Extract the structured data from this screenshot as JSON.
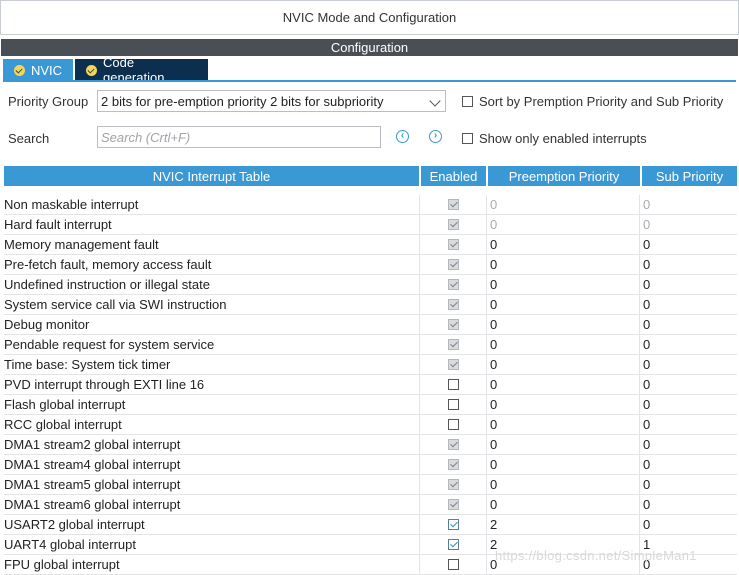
{
  "window": {
    "title": "NVIC Mode and Configuration"
  },
  "section": {
    "title": "Configuration"
  },
  "tabs": [
    {
      "label": "NVIC",
      "active": true
    },
    {
      "label": "Code generation",
      "active": false
    }
  ],
  "controls": {
    "priority_group_label": "Priority Group",
    "priority_group_value": "2 bits for pre-emption priority 2 bits for subpriority",
    "sort_label": "Sort by Premption Priority and Sub Priority",
    "search_label": "Search",
    "search_placeholder": "Search (Crtl+F)",
    "prev_glyph": "‹",
    "next_glyph": "›",
    "show_enabled_label": "Show only enabled interrupts"
  },
  "table": {
    "headers": {
      "name": "NVIC Interrupt Table",
      "enabled": "Enabled",
      "preemption": "Preemption Priority",
      "sub": "Sub Priority"
    },
    "rows": [
      {
        "name": "Non maskable interrupt",
        "enabled": "fixed",
        "preemption": "0",
        "sub": "0",
        "dim": true
      },
      {
        "name": "Hard fault interrupt",
        "enabled": "fixed",
        "preemption": "0",
        "sub": "0",
        "dim": true
      },
      {
        "name": "Memory management fault",
        "enabled": "fixed",
        "preemption": "0",
        "sub": "0",
        "dim": false
      },
      {
        "name": "Pre-fetch fault, memory access fault",
        "enabled": "fixed",
        "preemption": "0",
        "sub": "0",
        "dim": false
      },
      {
        "name": "Undefined instruction or illegal state",
        "enabled": "fixed",
        "preemption": "0",
        "sub": "0",
        "dim": false
      },
      {
        "name": "System service call via SWI instruction",
        "enabled": "fixed",
        "preemption": "0",
        "sub": "0",
        "dim": false
      },
      {
        "name": "Debug monitor",
        "enabled": "fixed",
        "preemption": "0",
        "sub": "0",
        "dim": false
      },
      {
        "name": "Pendable request for system service",
        "enabled": "fixed",
        "preemption": "0",
        "sub": "0",
        "dim": false
      },
      {
        "name": "Time base: System tick timer",
        "enabled": "fixed",
        "preemption": "0",
        "sub": "0",
        "dim": false
      },
      {
        "name": "PVD interrupt through EXTI line 16",
        "enabled": "off",
        "preemption": "0",
        "sub": "0",
        "dim": false
      },
      {
        "name": "Flash global interrupt",
        "enabled": "off",
        "preemption": "0",
        "sub": "0",
        "dim": false
      },
      {
        "name": "RCC global interrupt",
        "enabled": "off",
        "preemption": "0",
        "sub": "0",
        "dim": false
      },
      {
        "name": "DMA1 stream2 global interrupt",
        "enabled": "fixed",
        "preemption": "0",
        "sub": "0",
        "dim": false
      },
      {
        "name": "DMA1 stream4 global interrupt",
        "enabled": "fixed",
        "preemption": "0",
        "sub": "0",
        "dim": false
      },
      {
        "name": "DMA1 stream5 global interrupt",
        "enabled": "fixed",
        "preemption": "0",
        "sub": "0",
        "dim": false
      },
      {
        "name": "DMA1 stream6 global interrupt",
        "enabled": "fixed",
        "preemption": "0",
        "sub": "0",
        "dim": false
      },
      {
        "name": "USART2 global interrupt",
        "enabled": "on",
        "preemption": "2",
        "sub": "0",
        "dim": false
      },
      {
        "name": "UART4 global interrupt",
        "enabled": "on",
        "preemption": "2",
        "sub": "1",
        "dim": false
      },
      {
        "name": "FPU global interrupt",
        "enabled": "off",
        "preemption": "0",
        "sub": "0",
        "dim": false
      }
    ]
  },
  "watermark": "https://blog.csdn.net/SimpleMan1",
  "colors": {
    "accent": "#3a99d5",
    "tab_dark": "#0c2f4f",
    "section_bar": "#4a4f55"
  }
}
